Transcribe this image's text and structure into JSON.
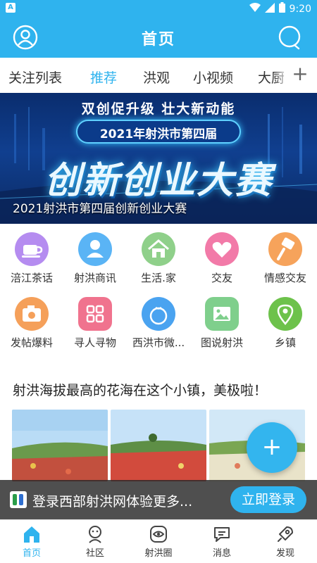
{
  "status_bar": {
    "time": "9:20",
    "app_badge": "A",
    "icons": [
      "wifi-icon",
      "signal-icon",
      "battery-icon"
    ]
  },
  "header": {
    "title": "首页",
    "left_icon": "user-avatar-icon",
    "right_icon": "search-icon"
  },
  "tabs": [
    {
      "label": "关注列表",
      "active": false
    },
    {
      "label": "推荐",
      "active": true
    },
    {
      "label": "洪观",
      "active": false
    },
    {
      "label": "小视频",
      "active": false
    },
    {
      "label": "大厨",
      "active": false
    }
  ],
  "tabs_more": "+",
  "banner": {
    "line1": "双创促升级 壮大新动能",
    "line2": "2021年射洪市第四届",
    "line3": "创新创业大赛",
    "caption": "2021射洪市第四届创新创业大赛"
  },
  "grid": [
    {
      "label": "涪江茶话",
      "icon": "teacup-icon",
      "color": "#b58cf0"
    },
    {
      "label": "射洪商讯",
      "icon": "person-icon",
      "color": "#5ab4f5"
    },
    {
      "label": "生活.家",
      "icon": "home-icon",
      "color": "#8fd08a"
    },
    {
      "label": "交友",
      "icon": "heart-icon",
      "color": "#f27aa8"
    },
    {
      "label": "情感交友",
      "icon": "brush-icon",
      "color": "#f6a35b"
    },
    {
      "label": "发帖爆料",
      "icon": "camera-icon",
      "color": "#f5a05a"
    },
    {
      "label": "寻人寻物",
      "icon": "apps-icon",
      "color": "#f0738e"
    },
    {
      "label": "西洪市微...",
      "icon": "fruit-icon",
      "color": "#4aa3f0"
    },
    {
      "label": "图说射洪",
      "icon": "image-icon",
      "color": "#7fcf8c"
    },
    {
      "label": "乡镇",
      "icon": "location-pin-icon",
      "color": "#6dc24b"
    }
  ],
  "article": {
    "title": "射洪海拔最高的花海在这个小镇，美极啦！"
  },
  "fab": "+",
  "login_bar": {
    "text": "登录西部射洪网体验更多...",
    "button": "立即登录"
  },
  "bottom_nav": [
    {
      "label": "首页",
      "icon": "home-nav-icon",
      "active": true
    },
    {
      "label": "社区",
      "icon": "community-icon",
      "active": false
    },
    {
      "label": "射洪圈",
      "icon": "circle-eye-icon",
      "active": false
    },
    {
      "label": "消息",
      "icon": "message-icon",
      "active": false
    },
    {
      "label": "发现",
      "icon": "rocket-icon",
      "active": false
    }
  ],
  "colors": {
    "brand": "#2fb3ee",
    "tab_active": "#2fb3ee"
  }
}
